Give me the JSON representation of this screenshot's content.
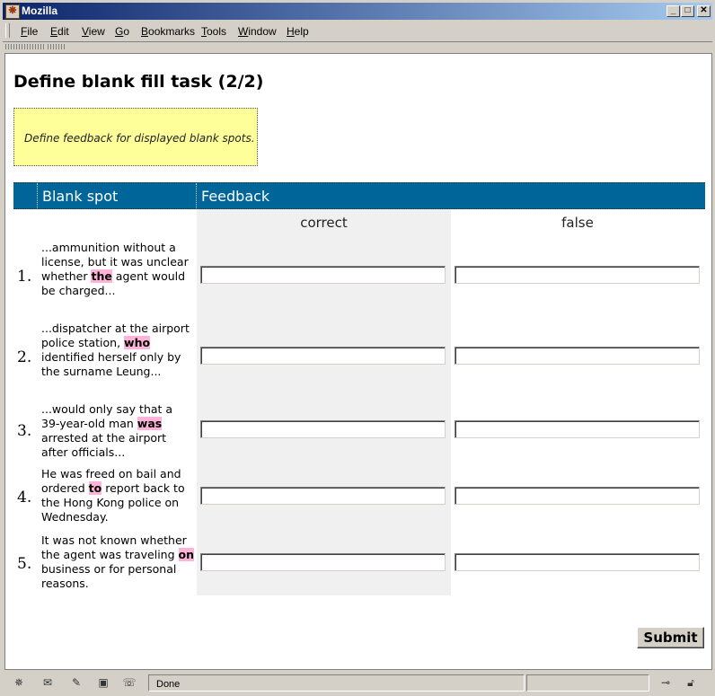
{
  "window": {
    "title": "Mozilla",
    "minimize": "_",
    "maximize": "□",
    "close": "✕"
  },
  "menu": {
    "items": [
      {
        "underline": "F",
        "rest": "ile"
      },
      {
        "underline": "E",
        "rest": "dit"
      },
      {
        "underline": "V",
        "rest": "iew"
      },
      {
        "underline": "G",
        "rest": "o"
      },
      {
        "underline": "B",
        "rest": "ookmarks"
      },
      {
        "underline": "T",
        "rest": "ools"
      },
      {
        "underline": "W",
        "rest": "indow"
      },
      {
        "underline": "H",
        "rest": "elp"
      }
    ]
  },
  "page": {
    "title": "Define blank fill task (2/2)",
    "hint": "Define feedback for displayed blank spots.",
    "header": {
      "blank_spot": "Blank spot",
      "feedback": "Feedback"
    },
    "columns": {
      "correct": "correct",
      "false": "false"
    },
    "rows": [
      {
        "num": "1.",
        "before": "...ammunition without a license, but it was unclear whether ",
        "blank": "the",
        "after": " agent would be charged...",
        "correct_value": "",
        "false_value": ""
      },
      {
        "num": "2.",
        "before": "...dispatcher at the airport police station, ",
        "blank": "who",
        "after": " identified herself only by the surname Leung...",
        "correct_value": "",
        "false_value": ""
      },
      {
        "num": "3.",
        "before": "...would only say that a 39-year-old man ",
        "blank": "was",
        "after": " arrested at the airport after officials...",
        "correct_value": "",
        "false_value": ""
      },
      {
        "num": "4.",
        "before": "He was freed on bail and ordered ",
        "blank": "to",
        "after": " report back to the Hong Kong police on Wednesday.",
        "correct_value": "",
        "false_value": ""
      },
      {
        "num": "5.",
        "before": "It was not known whether the agent was traveling ",
        "blank": "on",
        "after": " business or for personal reasons.",
        "correct_value": "",
        "false_value": ""
      }
    ],
    "submit_label": "Submit"
  },
  "status": {
    "text": "Done"
  },
  "icons": {
    "app": "mozilla-icon",
    "status": [
      "navigator-icon",
      "mail-icon",
      "composer-icon",
      "address-book-icon",
      "irc-chat-icon"
    ],
    "online": "online-icon",
    "security": "security-lock-icon"
  },
  "colors": {
    "header_bg": "#006699",
    "hint_bg": "#ffff99",
    "highlight": "#ffb3d9",
    "title_grad_start": "#0a246a"
  }
}
